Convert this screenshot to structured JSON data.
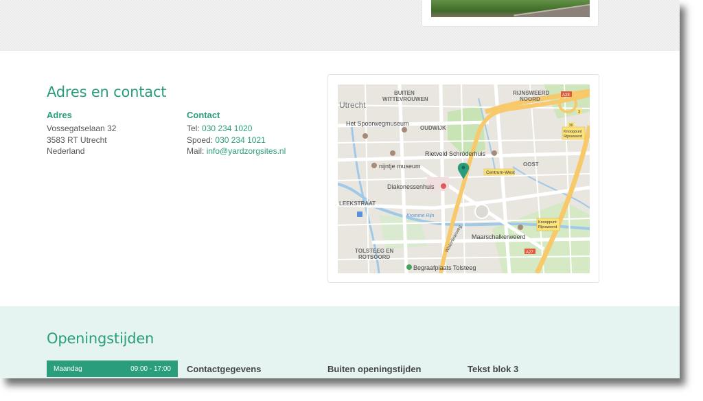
{
  "address_section": {
    "title": "Adres en contact",
    "address": {
      "heading": "Adres",
      "line1": "Vossegatselaan 32",
      "line2": "3583 RT Utrecht",
      "line3": "Nederland"
    },
    "contact": {
      "heading": "Contact",
      "tel_label": "Tel:",
      "tel_value": "030 234 1020",
      "spoed_label": "Spoed:",
      "spoed_value": "030 234 1021",
      "mail_label": "Mail:",
      "mail_value": "info@yardzorgsites.nl"
    }
  },
  "map": {
    "labels": {
      "buiten": "BUITEN",
      "wittevrouwen": "WITTEVROUWEN",
      "rijnsweerd": "RIJNSWEERD",
      "noord": "NOORD",
      "utrecht": "Utrecht",
      "spoorwegmuseum": "Het Spoorwegmuseum",
      "oudwijk": "OUDWIJK",
      "rietveld": "Rietveld Schröderhuis",
      "nijntje": "nijntje museum",
      "oost": "OOST",
      "centrum_west": "Centrum-West",
      "diakonessenhuis": "Diakonessenhuis",
      "leekstraat": "LEEKSTRAAT",
      "maarschalkerweerd": "Maarschalkerweerd",
      "tolsteeg": "TOLSTEEG EN",
      "rotsoord": "ROTSOORD",
      "begraafplaats": "Begraafplaats Tolsteeg",
      "waterlinieweg": "Waterlinieweg",
      "kromme_rijn": "Kromme Rijn",
      "knooppunt1": "Knooppunt",
      "rijnsweerd_box": "Rijnsweerd",
      "knooppunt2": "Knooppunt",
      "rijnsweerd_box2": "Rijnsweerd",
      "a28": "A28",
      "a27": "A27",
      "n30": "30",
      "n2": "2"
    },
    "colors": {
      "land": "#e9e6df",
      "park": "#c8e4b4",
      "water": "#9fc9e8",
      "highway": "#f7c96b",
      "road": "#ffffff",
      "pin": "#2a9d7c"
    }
  },
  "hours_section": {
    "title": "Openingstijden",
    "day_label": "Maandag",
    "day_hours": "09:00 - 17:00",
    "columns": [
      "Contactgegevens",
      "Buiten openingstijden",
      "Tekst blok 3"
    ]
  },
  "colors": {
    "accent": "#2a9d7c",
    "band": "#e5f4f1"
  }
}
